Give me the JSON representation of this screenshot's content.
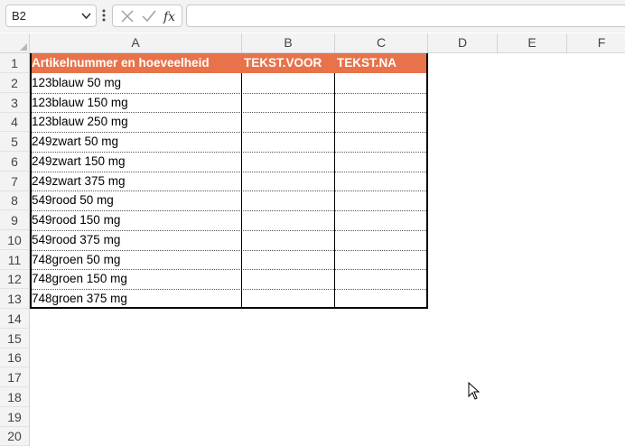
{
  "formula_bar": {
    "name_box": "B2",
    "formula": ""
  },
  "icons": {
    "name_box_dropdown": "chevron-down-icon",
    "more": "vertical-dots-icon",
    "cancel": "cancel-x-icon",
    "enter": "checkmark-icon",
    "function": "fx-icon",
    "cursor": "mouse-pointer-icon"
  },
  "columns": [
    "A",
    "B",
    "C",
    "D",
    "E",
    "F"
  ],
  "rows": [
    "1",
    "2",
    "3",
    "4",
    "5",
    "6",
    "7",
    "8",
    "9",
    "10",
    "11",
    "12",
    "13",
    "14",
    "15",
    "16",
    "17",
    "18",
    "19",
    "20"
  ],
  "table": {
    "headers": [
      "Artikelnummer en hoeveelheid",
      "TEKST.VOOR",
      "TEKST.NA"
    ],
    "items": [
      "123blauw 50 mg",
      "123blauw 150 mg",
      "123blauw 250 mg",
      "249zwart 50 mg",
      "249zwart 150 mg",
      "249zwart 375 mg",
      "549rood 50 mg",
      "549rood 150 mg",
      "549rood 375 mg",
      "748groen 50 mg",
      "748groen 150 mg",
      "748groen 375 mg"
    ]
  },
  "colors": {
    "header_fill": "#e8734a",
    "header_text": "#ffffff"
  }
}
